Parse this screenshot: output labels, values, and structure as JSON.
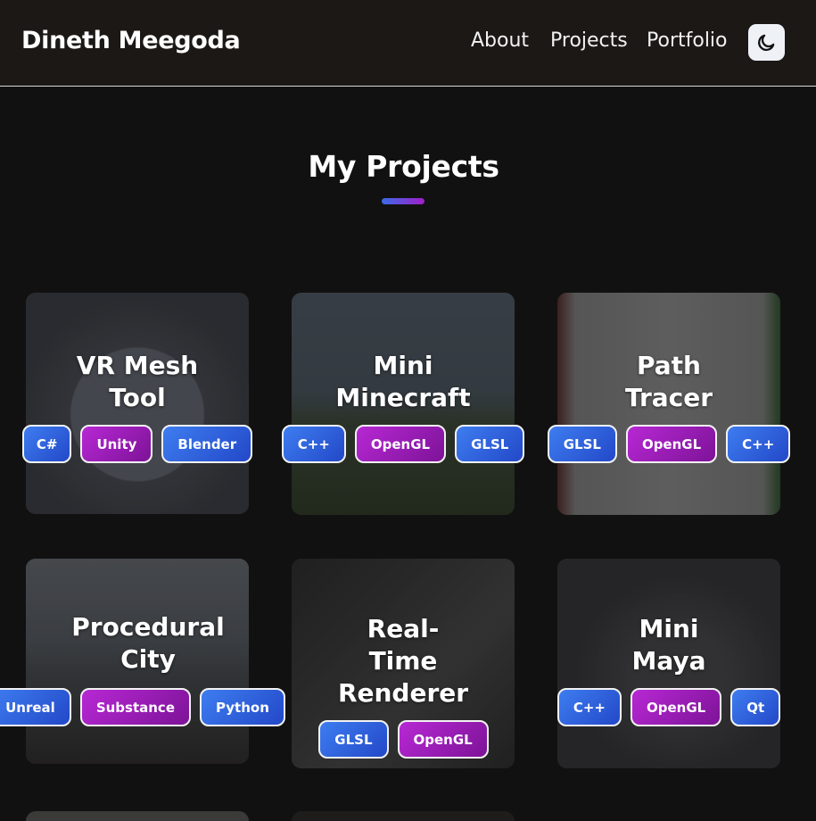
{
  "header": {
    "brand": "Dineth Meegoda",
    "nav": [
      "About",
      "Projects",
      "Portfolio"
    ],
    "theme_icon": "moon-icon"
  },
  "section": {
    "title": "My Projects"
  },
  "projects": [
    {
      "title_lines": [
        "VR Mesh",
        "Tool"
      ],
      "tags": [
        "C#",
        "Unity",
        "Blender"
      ]
    },
    {
      "title_lines": [
        "Mini",
        "Minecraft"
      ],
      "tags": [
        "C++",
        "OpenGL",
        "GLSL"
      ]
    },
    {
      "title_lines": [
        "Path",
        "Tracer"
      ],
      "tags": [
        "GLSL",
        "OpenGL",
        "C++"
      ]
    },
    {
      "title_lines": [
        "Procedural",
        "City"
      ],
      "tags": [
        "Unreal",
        "Substance",
        "Python"
      ]
    },
    {
      "title_lines": [
        "Real-",
        "Time",
        "Renderer"
      ],
      "tags": [
        "GLSL",
        "OpenGL"
      ]
    },
    {
      "title_lines": [
        "Mini",
        "Maya"
      ],
      "tags": [
        "C++",
        "OpenGL",
        "Qt"
      ]
    }
  ],
  "colors": {
    "tag_blue": "#3e7df0",
    "tag_purple": "#b728d4",
    "background": "#121111",
    "header": "#1b1816"
  }
}
